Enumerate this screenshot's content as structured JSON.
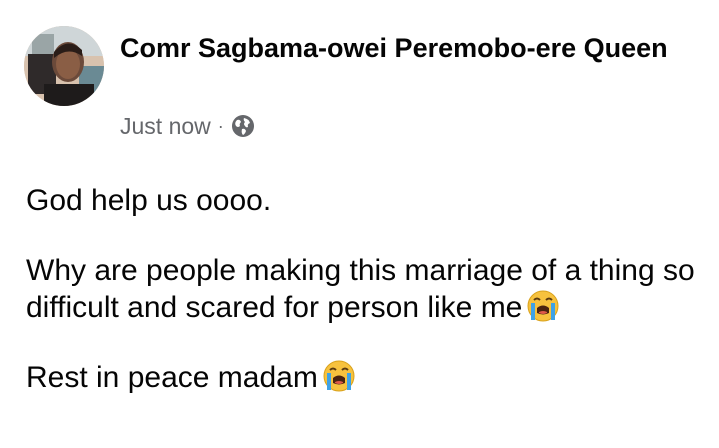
{
  "post": {
    "author_name": "Comr Sagbama-owei Peremobo-ere Queen",
    "timestamp": "Just now",
    "separator": "·",
    "audience_icon": "globe-icon",
    "paragraphs": [
      {
        "text": "God help us oooo.",
        "emoji": null
      },
      {
        "text": "Why are people making this marriage of a thing so difficult and scared for person like me",
        "emoji": "loudly-crying-face-emoji"
      },
      {
        "text": "Rest in peace madam",
        "emoji": "loudly-crying-face-emoji"
      }
    ]
  },
  "colors": {
    "text": "#050505",
    "meta": "#65676b",
    "background": "#ffffff",
    "emoji_face": "#f7c23e",
    "emoji_tears": "#3fa2e6"
  }
}
